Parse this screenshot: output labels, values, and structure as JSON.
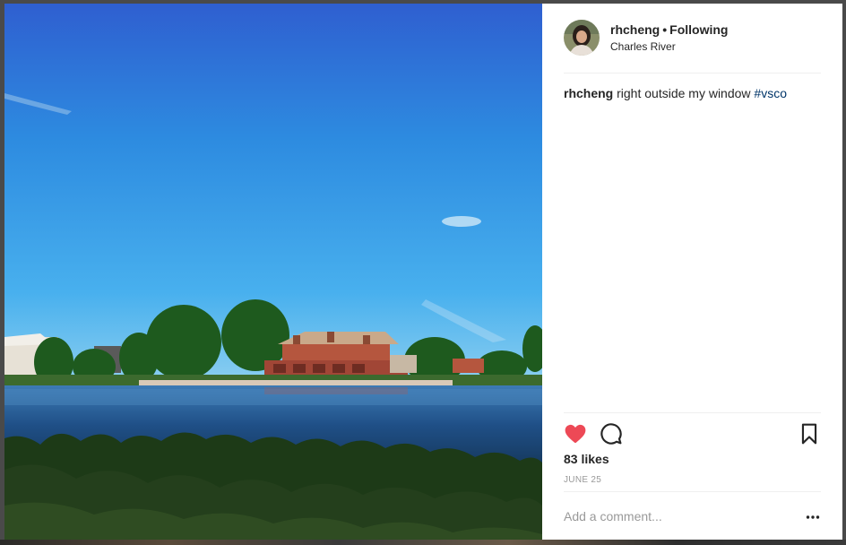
{
  "post": {
    "username": "rhcheng",
    "separator": "•",
    "follow_state": "Following",
    "location": "Charles River",
    "caption_user": "rhcheng",
    "caption_text": " right outside my window ",
    "caption_hashtag": "#vsco",
    "likes": "83 likes",
    "date": "JUNE 25",
    "comment_placeholder": "Add a comment...",
    "liked": true
  },
  "icons": {
    "like": "heart-icon",
    "comment": "comment-bubble-icon",
    "save": "bookmark-icon",
    "more": "more-options-icon"
  },
  "colors": {
    "like_red": "#ed4956",
    "text": "#262626",
    "muted": "#999999",
    "hashtag": "#003569"
  }
}
